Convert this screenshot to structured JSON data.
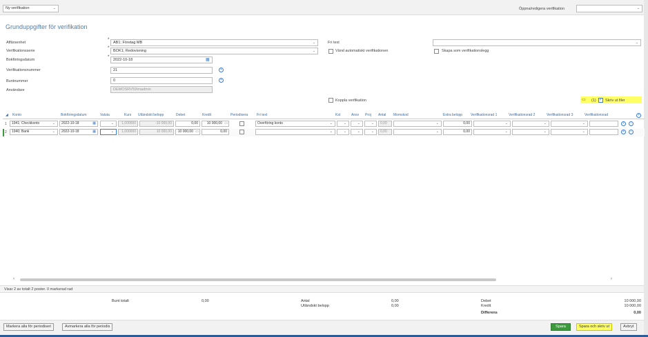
{
  "topbar": {
    "ver_type": "Ny verifikation",
    "open_label": "Öppna/redigera verifikation",
    "open_value": ""
  },
  "section_title": "Grunduppgifter för verifikation",
  "form": {
    "affarsenhet_label": "Affärsenhet",
    "affarsenhet_value": "AB1; Företag MB",
    "serie_label": "Verifikationsserie",
    "serie_value": "BOK1; Redovisning",
    "bokforingsdatum_label": "Bokföringsdatum",
    "bokforingsdatum_value": "2022-10-18",
    "vernr_label": "Verifikationsnummer",
    "vernr_value": "21",
    "buntnr_label": "Buntnummer",
    "buntnr_value": "0",
    "anvandare_label": "Användare",
    "anvandare_value": "DEMOSRV59\\madmin",
    "fritext_label": "Fri text",
    "fritext_value": "",
    "vand_label": "Vänd automatiskt verifikationen",
    "skapa_label": "Skapa som verifikationslegg",
    "koppla_label": "Koppla verifikation",
    "files_count": "(1)",
    "skriv_ut_label": "Skriv ut filer"
  },
  "grid": {
    "headers": [
      "Konto",
      "Bokföringsdatum",
      "Valuta",
      "Kurs",
      "Utländskt belopp",
      "Debet",
      "Kredit",
      "Periodisera",
      "Fri text",
      "Kst",
      "Ansv",
      "Proj",
      "Antal",
      "Momskod",
      "Extra belopp",
      "Verifikationsrad 1",
      "Verifikationsrad 2",
      "Verifikationsrad 3",
      "Verifikationsrad"
    ],
    "rows": [
      {
        "nr": "1",
        "konto": "1941; Checkkonto",
        "datum": "2022-10-18",
        "valuta": "",
        "kurs": "1,000000",
        "utl": "-10 000,00",
        "debet": "0,00",
        "kredit": "10 000,00",
        "fritext": "Överföring konto",
        "antal": "0,00",
        "extra": "0,00"
      },
      {
        "nr": "2",
        "konto": "1940; Bank",
        "datum": "2022-10-18",
        "valuta": "",
        "kurs": "1,000000",
        "utl": "10 000,00",
        "debet": "10 000,00",
        "kredit": "0,00",
        "fritext": "",
        "antal": "0,00",
        "extra": "0,00"
      }
    ]
  },
  "status": "Visar 2 av totalt 2 poster. 0 markerad rad",
  "totals": {
    "bunt_label": "Bunt totalt",
    "bunt_value": "0,00",
    "antal_label": "Antal",
    "antal_value": "0,00",
    "utl_label": "Utländskt belopp",
    "utl_value": "0,00",
    "debet_label": "Debet",
    "debet_value": "10 000,00",
    "kredit_label": "Kredit",
    "kredit_value": "10 000,00",
    "diff_label": "Differens",
    "diff_value": "0,00"
  },
  "buttons": {
    "markera": "Markera alla för periodiseri",
    "avmarkera": "Avmarkera alla för periodis",
    "spara": "Spara",
    "spara_skriv": "Spara och skriv ut",
    "avbryt": "Avbryt"
  },
  "colors": {
    "accent": "#4a7fb0",
    "green": "#3c9a3c",
    "highlight": "#ffff66"
  }
}
